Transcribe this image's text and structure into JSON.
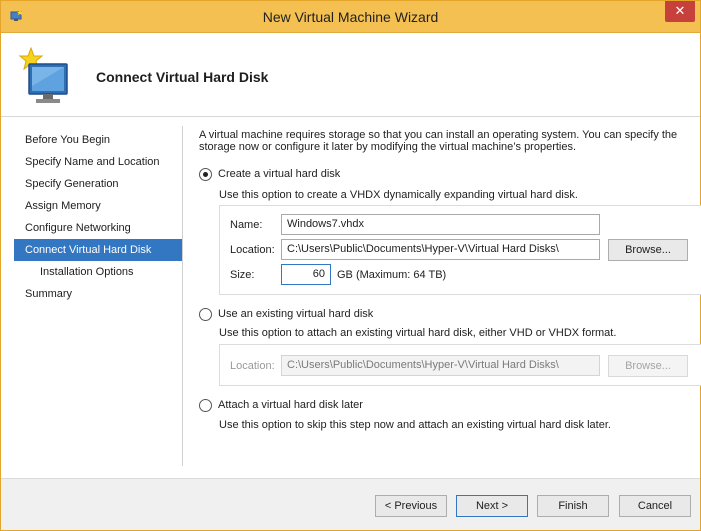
{
  "window": {
    "title": "New Virtual Machine Wizard",
    "close_glyph": "✕",
    "accent_color": "#f4c051"
  },
  "header": {
    "title": "Connect Virtual Hard Disk",
    "icon": "wizard-monitor-icon"
  },
  "nav": {
    "items": [
      {
        "label": "Before You Begin",
        "active": false,
        "sub": false
      },
      {
        "label": "Specify Name and Location",
        "active": false,
        "sub": false
      },
      {
        "label": "Specify Generation",
        "active": false,
        "sub": false
      },
      {
        "label": "Assign Memory",
        "active": false,
        "sub": false
      },
      {
        "label": "Configure Networking",
        "active": false,
        "sub": false
      },
      {
        "label": "Connect Virtual Hard Disk",
        "active": true,
        "sub": false
      },
      {
        "label": "Installation Options",
        "active": false,
        "sub": true
      },
      {
        "label": "Summary",
        "active": false,
        "sub": false
      }
    ],
    "active_color": "#3376c2"
  },
  "content": {
    "intro_line1": "A virtual machine requires storage so that you can install an operating system. You can specify the",
    "intro_line2": "storage now or configure it later by modifying the virtual machine’s properties.",
    "create": {
      "label": "Create a virtual hard disk",
      "selected": true,
      "description": "Use this option to create a VHDX dynamically expanding virtual hard disk.",
      "name_label": "Name:",
      "name_value": "Windows7.vhdx",
      "location_label": "Location:",
      "location_value": "C:\\Users\\Public\\Documents\\Hyper-V\\Virtual Hard Disks\\",
      "browse_label": "Browse...",
      "size_label": "Size:",
      "size_value": "60",
      "size_unit": "GB (Maximum: 64 TB)"
    },
    "existing": {
      "label": "Use an existing virtual hard disk",
      "selected": false,
      "description": "Use this option to attach an existing virtual hard disk, either VHD or VHDX format.",
      "location_label": "Location:",
      "location_value": "C:\\Users\\Public\\Documents\\Hyper-V\\Virtual Hard Disks\\",
      "browse_label": "Browse..."
    },
    "later": {
      "label": "Attach a virtual hard disk later",
      "selected": false,
      "description": "Use this option to skip this step now and attach an existing virtual hard disk later."
    }
  },
  "footer": {
    "previous": "< Previous",
    "next": "Next >",
    "finish": "Finish",
    "cancel": "Cancel"
  }
}
